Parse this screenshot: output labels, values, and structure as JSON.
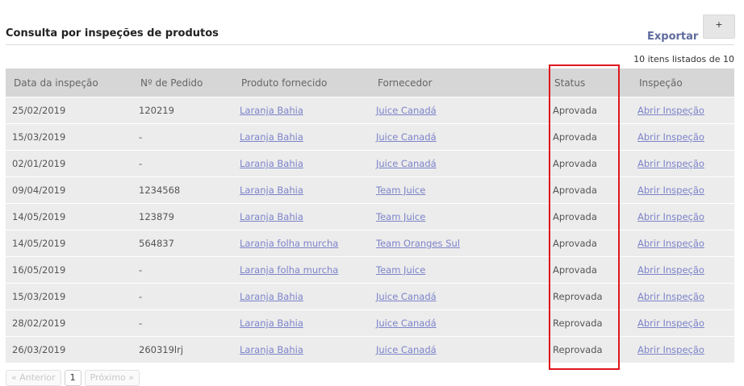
{
  "header": {
    "title": "Consulta por inspeções de produtos",
    "export_label": "Exportar",
    "add_label": "+"
  },
  "summary": {
    "count_text": "10 itens listados de 10"
  },
  "table": {
    "columns": [
      "Data da inspeção",
      "Nº de Pedido",
      "Produto fornecido",
      "Fornecedor",
      "Status",
      "Inspeção"
    ],
    "rows": [
      {
        "date": "25/02/2019",
        "order": "120219",
        "product": "Laranja Bahia",
        "supplier": "Juice Canadá",
        "status": "Aprovada",
        "action": "Abrir Inspeção"
      },
      {
        "date": "15/03/2019",
        "order": "-",
        "product": "Laranja Bahia",
        "supplier": "Juice Canadá",
        "status": "Aprovada",
        "action": "Abrir Inspeção"
      },
      {
        "date": "02/01/2019",
        "order": "-",
        "product": "Laranja Bahia",
        "supplier": "Juice Canadá",
        "status": "Aprovada",
        "action": "Abrir Inspeção"
      },
      {
        "date": "09/04/2019",
        "order": "1234568",
        "product": "Laranja Bahia",
        "supplier": "Team Juice",
        "status": "Aprovada",
        "action": "Abrir Inspeção"
      },
      {
        "date": "14/05/2019",
        "order": "123879",
        "product": "Laranja Bahia",
        "supplier": "Team Juice",
        "status": "Aprovada",
        "action": "Abrir Inspeção"
      },
      {
        "date": "14/05/2019",
        "order": "564837",
        "product": "Laranja folha murcha",
        "supplier": "Team Oranges Sul",
        "status": "Aprovada",
        "action": "Abrir Inspeção"
      },
      {
        "date": "16/05/2019",
        "order": "-",
        "product": "Laranja folha murcha",
        "supplier": "Team Juice",
        "status": "Aprovada",
        "action": "Abrir Inspeção"
      },
      {
        "date": "15/03/2019",
        "order": "-",
        "product": "Laranja Bahia",
        "supplier": "Juice Canadá",
        "status": "Reprovada",
        "action": "Abrir Inspeção"
      },
      {
        "date": "28/02/2019",
        "order": "-",
        "product": "Laranja Bahia",
        "supplier": "Juice Canadá",
        "status": "Reprovada",
        "action": "Abrir Inspeção"
      },
      {
        "date": "26/03/2019",
        "order": "260319lrj",
        "product": "Laranja Bahia",
        "supplier": "Juice Canadá",
        "status": "Reprovada",
        "action": "Abrir Inspeção"
      }
    ]
  },
  "pagination": {
    "prev_label": "« Anterior",
    "current_page": "1",
    "next_label": "Próximo »"
  },
  "colors": {
    "highlight": "#e0161d",
    "link": "#7c83c9",
    "header_bg": "#d6d6d6",
    "row_bg": "#ececec"
  }
}
